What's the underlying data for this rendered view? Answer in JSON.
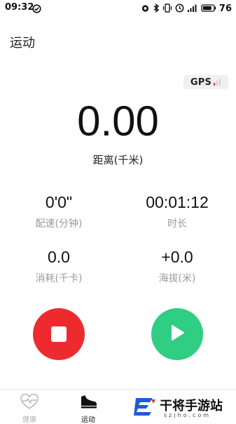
{
  "status_bar": {
    "time": "09:32",
    "battery": "76",
    "icons": [
      "check-circle-icon",
      "alarm-icon",
      "bluetooth-icon",
      "vibrate-icon",
      "clock-icon",
      "signal-icon",
      "battery-icon"
    ]
  },
  "header": {
    "title": "运动"
  },
  "gps": {
    "label": "GPS",
    "signal_color": "#e53935"
  },
  "distance": {
    "value": "0.00",
    "label": "距离(千米)"
  },
  "stats": {
    "pace": {
      "value": "0'0\"",
      "label": "配速(分钟)"
    },
    "duration": {
      "value": "00:01:12",
      "label": "时长"
    },
    "calories": {
      "value": "0.0",
      "label": "消耗(千卡)"
    },
    "altitude": {
      "value": "+0.0",
      "label": "海拔(米)"
    }
  },
  "controls": {
    "stop_color": "#ed2b2f",
    "start_color": "#2fce82"
  },
  "tabbar": {
    "tabs": [
      {
        "label": "健康",
        "icon": "heart-pulse-icon",
        "active": false
      },
      {
        "label": "运动",
        "icon": "shoe-icon",
        "active": true
      }
    ]
  },
  "watermark": {
    "text": "干将手游站",
    "sub": "szjho.com"
  }
}
